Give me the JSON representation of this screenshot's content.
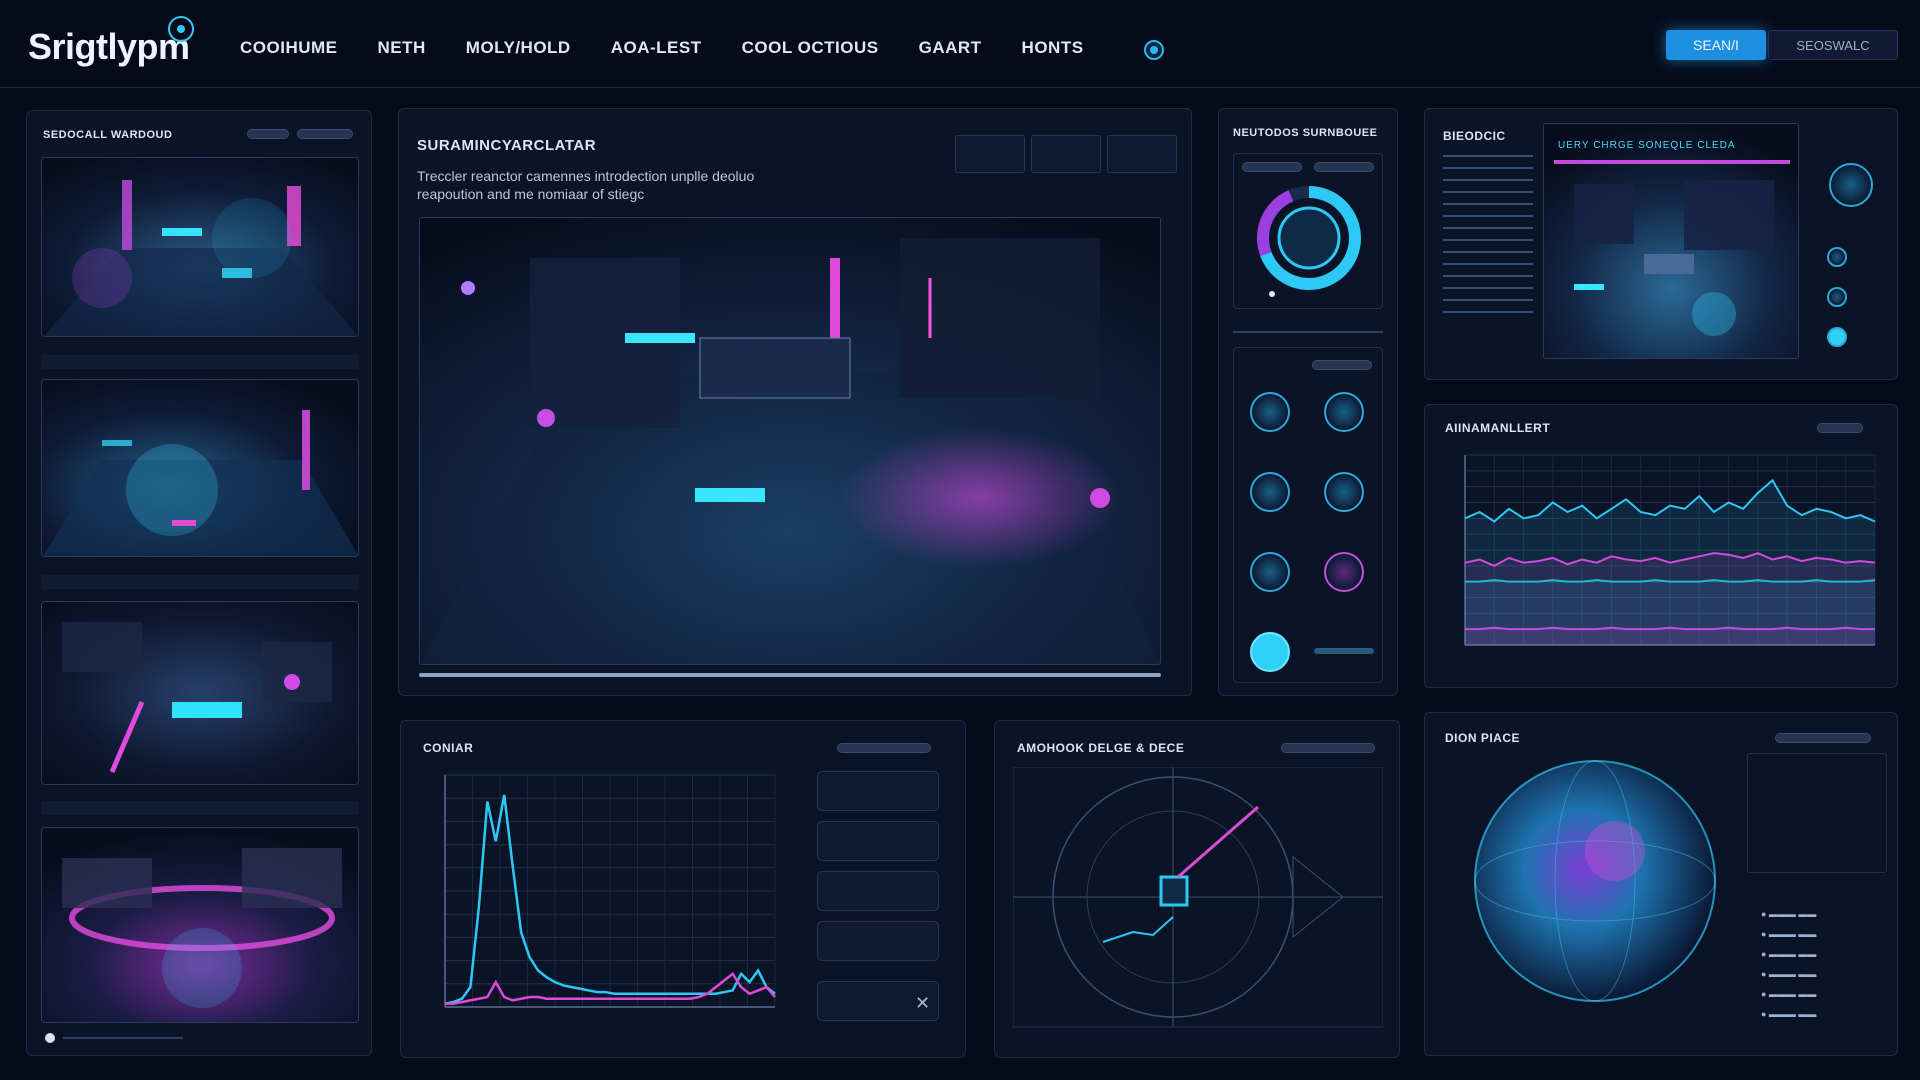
{
  "app": {
    "logo": "Srigtlypm"
  },
  "nav": {
    "items": [
      "COOIHUME",
      "NETH",
      "MOLY/HOLD",
      "AOA-LEST",
      "COOL OCTIOUS",
      "GAART",
      "HONTS"
    ],
    "primary_button": "SEAN/I",
    "secondary_button": "SEOSWALC"
  },
  "left_panel": {
    "title": "SEDOCALL WARDOUD",
    "thumb_labels": [
      "",
      "",
      "",
      ""
    ]
  },
  "main_view": {
    "title": "SURAMINCYARCLATAR",
    "description_line1": "Treccler reanctor camennes introdection unplle deoluo",
    "description_line2": "reapoution and me nomiaar of stiegc"
  },
  "summary_panel": {
    "title": "NEUTODOS SURNBOUEE"
  },
  "right_top_panel": {
    "title": "BIEODCIC",
    "banner": "UERY CHRGE SONEQLE CLEDA"
  },
  "chart_panel": {
    "title": "AIINAMANLLERT"
  },
  "conbar_panel": {
    "title": "CONIAR"
  },
  "radar_panel": {
    "title": "AMOHOOK DELGE & DECE"
  },
  "sphere_panel": {
    "title": "DION PIACE"
  },
  "colors": {
    "background": "#060b1a",
    "panel": "#0b1326",
    "cyan": "#2ec8f5",
    "magenta": "#d24ae0",
    "accent_blue": "#1e8fe0"
  },
  "chart_data": [
    {
      "type": "line",
      "title": "AIINAMANLLERT",
      "x": [
        0,
        1,
        2,
        3,
        4,
        5,
        6,
        7,
        8,
        9,
        10,
        11,
        12,
        13,
        14,
        15,
        16,
        17,
        18,
        19,
        20,
        21,
        22,
        23,
        24,
        25,
        26,
        27,
        28
      ],
      "series": [
        {
          "values": [
            80,
            84,
            78,
            86,
            80,
            82,
            90,
            84,
            88,
            80,
            86,
            92,
            84,
            82,
            88,
            86,
            94,
            84,
            90,
            86,
            96,
            104,
            88,
            82,
            86,
            84,
            80,
            82,
            78
          ]
        },
        {
          "values": [
            52,
            54,
            50,
            55,
            52,
            53,
            55,
            51,
            54,
            52,
            56,
            54,
            53,
            55,
            52,
            54,
            56,
            58,
            57,
            55,
            58,
            54,
            56,
            53,
            55,
            54,
            52,
            53,
            52
          ]
        },
        {
          "values": [
            40,
            40,
            41,
            40,
            40,
            40,
            41,
            40,
            40,
            41,
            40,
            40,
            40,
            41,
            40,
            40,
            40,
            41,
            40,
            40,
            41,
            40,
            40,
            40,
            41,
            40,
            40,
            40,
            41
          ]
        },
        {
          "values": [
            10,
            10,
            11,
            10,
            10,
            10,
            11,
            10,
            10,
            10,
            11,
            10,
            10,
            10,
            11,
            10,
            10,
            10,
            11,
            10,
            10,
            10,
            11,
            10,
            10,
            10,
            11,
            10,
            10
          ]
        }
      ],
      "ylim": [
        0,
        120
      ],
      "grid": true
    },
    {
      "type": "line",
      "title": "CONIAR",
      "x": [
        0,
        1,
        2,
        3,
        4,
        5,
        6,
        7,
        8,
        9,
        10,
        11,
        12,
        13,
        14,
        15,
        16,
        17,
        18,
        19,
        20,
        21,
        22,
        23,
        24,
        25,
        26,
        27,
        28,
        29,
        30,
        31,
        32,
        33,
        34,
        35,
        36,
        37,
        38,
        39
      ],
      "series": [
        {
          "values": [
            2,
            3,
            5,
            12,
            60,
            124,
            100,
            128,
            85,
            45,
            30,
            22,
            18,
            15,
            13,
            12,
            11,
            10,
            9,
            9,
            8,
            8,
            8,
            8,
            8,
            8,
            8,
            8,
            8,
            8,
            8,
            8,
            8,
            9,
            10,
            20,
            15,
            22,
            12,
            8
          ]
        },
        {
          "values": [
            2,
            2,
            3,
            4,
            5,
            6,
            15,
            6,
            4,
            5,
            6,
            6,
            5,
            5,
            5,
            5,
            5,
            5,
            5,
            5,
            5,
            5,
            5,
            5,
            5,
            5,
            5,
            5,
            5,
            5,
            6,
            8,
            12,
            16,
            20,
            12,
            8,
            10,
            12,
            6
          ]
        }
      ],
      "ylim": [
        0,
        140
      ],
      "grid": true
    }
  ]
}
